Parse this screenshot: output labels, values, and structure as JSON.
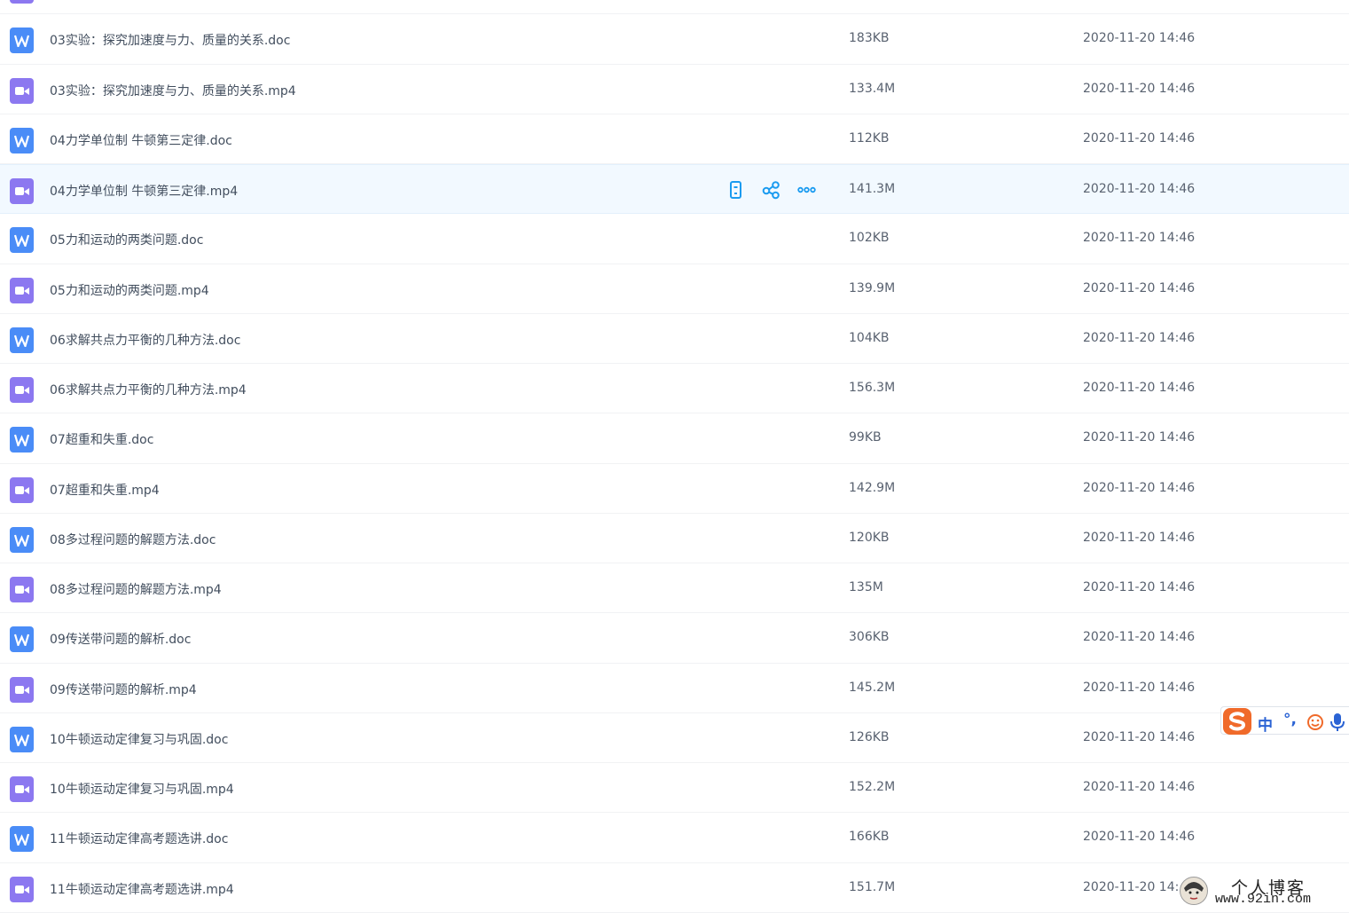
{
  "files": [
    {
      "name": "",
      "size": "",
      "date": "",
      "type": "mp4",
      "partial": true
    },
    {
      "name": "03实验：探究加速度与力、质量的关系.doc",
      "size": "183KB",
      "date": "2020-11-20 14:46",
      "type": "doc"
    },
    {
      "name": "03实验：探究加速度与力、质量的关系.mp4",
      "size": "133.4M",
      "date": "2020-11-20 14:46",
      "type": "mp4"
    },
    {
      "name": "04力学单位制 牛顿第三定律.doc",
      "size": "112KB",
      "date": "2020-11-20 14:46",
      "type": "doc"
    },
    {
      "name": "04力学单位制 牛顿第三定律.mp4",
      "size": "141.3M",
      "date": "2020-11-20 14:46",
      "type": "mp4",
      "hovered": true
    },
    {
      "name": "05力和运动的两类问题.doc",
      "size": "102KB",
      "date": "2020-11-20 14:46",
      "type": "doc"
    },
    {
      "name": "05力和运动的两类问题.mp4",
      "size": "139.9M",
      "date": "2020-11-20 14:46",
      "type": "mp4"
    },
    {
      "name": "06求解共点力平衡的几种方法.doc",
      "size": "104KB",
      "date": "2020-11-20 14:46",
      "type": "doc"
    },
    {
      "name": "06求解共点力平衡的几种方法.mp4",
      "size": "156.3M",
      "date": "2020-11-20 14:46",
      "type": "mp4"
    },
    {
      "name": "07超重和失重.doc",
      "size": "99KB",
      "date": "2020-11-20 14:46",
      "type": "doc"
    },
    {
      "name": "07超重和失重.mp4",
      "size": "142.9M",
      "date": "2020-11-20 14:46",
      "type": "mp4"
    },
    {
      "name": "08多过程问题的解题方法.doc",
      "size": "120KB",
      "date": "2020-11-20 14:46",
      "type": "doc"
    },
    {
      "name": "08多过程问题的解题方法.mp4",
      "size": "135M",
      "date": "2020-11-20 14:46",
      "type": "mp4"
    },
    {
      "name": "09传送带问题的解析.doc",
      "size": "306KB",
      "date": "2020-11-20 14:46",
      "type": "doc"
    },
    {
      "name": "09传送带问题的解析.mp4",
      "size": "145.2M",
      "date": "2020-11-20 14:46",
      "type": "mp4"
    },
    {
      "name": "10牛顿运动定律复习与巩固.doc",
      "size": "126KB",
      "date": "2020-11-20 14:46",
      "type": "doc"
    },
    {
      "name": "10牛顿运动定律复习与巩固.mp4",
      "size": "152.2M",
      "date": "2020-11-20 14:46",
      "type": "mp4"
    },
    {
      "name": "11牛顿运动定律高考题选讲.doc",
      "size": "166KB",
      "date": "2020-11-20 14:46",
      "type": "doc"
    },
    {
      "name": "11牛顿运动定律高考题选讲.mp4",
      "size": "151.7M",
      "date": "2020-11-20 14:",
      "type": "mp4"
    }
  ],
  "row_actions": [
    "phone-icon",
    "share-icon",
    "more-icon"
  ],
  "icons": {
    "doc": "word-doc-icon",
    "mp4": "video-file-icon"
  },
  "colors": {
    "hover_row": "#f2f9ff",
    "action_blue": "#1a9bf0",
    "doc_icon": "#4a8cf7",
    "video_icon": "#8c78f0",
    "ime_logo": "#f06a2a",
    "ime_blue": "#2b63d4"
  },
  "ime": {
    "mode": "中",
    "punct": "°,"
  },
  "watermark": {
    "title": "个人博客",
    "url": "www.92in.com"
  }
}
